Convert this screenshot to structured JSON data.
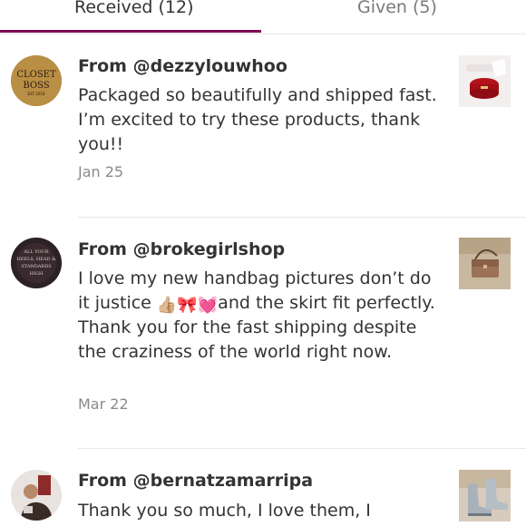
{
  "tabs": {
    "received_label": "Received (12)",
    "given_label": "Given (5)",
    "active": "received",
    "accent_color": "#7f0353"
  },
  "reviews": [
    {
      "from": "From @dezzylouwhoo",
      "avatar_text": [
        "CLOSET",
        "BOSS",
        "EST 2018"
      ],
      "text": "Packaged so beautifully and shipped fast. I’m excited to try these products, thank you!!",
      "date": "Jan 25",
      "thumbnail": "skincare-jar-photo"
    },
    {
      "from": "From @brokegirlshop",
      "avatar_text": [
        "ALL YOUR",
        "HEELS, HEAD &",
        "STANDARDS",
        "HIGH"
      ],
      "text_before": "I love my new handbag pictures don’t do it justice ",
      "emojis": [
        "👍🏼",
        "🎀",
        "💓"
      ],
      "text_after": "and the skirt fit perfectly. Thank you for the fast shipping despite the craziness of the world right now.",
      "date": "Mar 22",
      "thumbnail": "handbag-photo"
    },
    {
      "from": "From @bernatzamarripa",
      "text": "Thank you so much, I love them, I",
      "thumbnail": "boots-photo"
    }
  ]
}
